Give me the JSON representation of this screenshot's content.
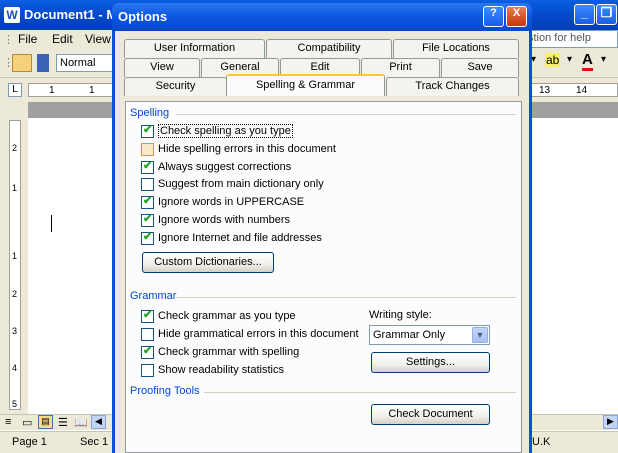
{
  "word": {
    "title": "Document1 - M",
    "menu": [
      "File",
      "Edit",
      "View"
    ],
    "help_placeholder": "stion for help",
    "style_value": "Normal",
    "ruler_numbers": [
      "1",
      "1",
      "13",
      "14"
    ],
    "vruler_numbers": [
      "2",
      "1",
      "1",
      "2",
      "3",
      "4",
      "5"
    ],
    "status": {
      "page": "Page  1",
      "sec": "Sec  1",
      "lang": "U.K"
    }
  },
  "dialog": {
    "title": "Options",
    "help_button": "?",
    "close_button": "X",
    "tabs_row1": [
      "User Information",
      "Compatibility",
      "File Locations"
    ],
    "tabs_row2": [
      "View",
      "General",
      "Edit",
      "Print",
      "Save"
    ],
    "tabs_row3": [
      "Security",
      "Spelling & Grammar",
      "Track Changes"
    ],
    "spelling": {
      "label": "Spelling",
      "options": [
        {
          "label": "Check spelling as you type",
          "checked": true
        },
        {
          "label": "Hide spelling errors in this document",
          "checked": false
        },
        {
          "label": "Always suggest corrections",
          "checked": true
        },
        {
          "label": "Suggest from main dictionary only",
          "checked": false
        },
        {
          "label": "Ignore words in UPPERCASE",
          "checked": true
        },
        {
          "label": "Ignore words with numbers",
          "checked": true
        },
        {
          "label": "Ignore Internet and file addresses",
          "checked": true
        }
      ],
      "custom_dictionaries_button": "Custom Dictionaries..."
    },
    "grammar": {
      "label": "Grammar",
      "options": [
        {
          "label": "Check grammar as you type",
          "checked": true
        },
        {
          "label": "Hide grammatical errors in this document",
          "checked": false
        },
        {
          "label": "Check grammar with spelling",
          "checked": true
        },
        {
          "label": "Show readability statistics",
          "checked": false
        }
      ],
      "writing_style_label": "Writing style:",
      "writing_style_value": "Grammar Only",
      "settings_button": "Settings..."
    },
    "proofing": {
      "label": "Proofing Tools",
      "check_document_button": "Check Document"
    }
  }
}
